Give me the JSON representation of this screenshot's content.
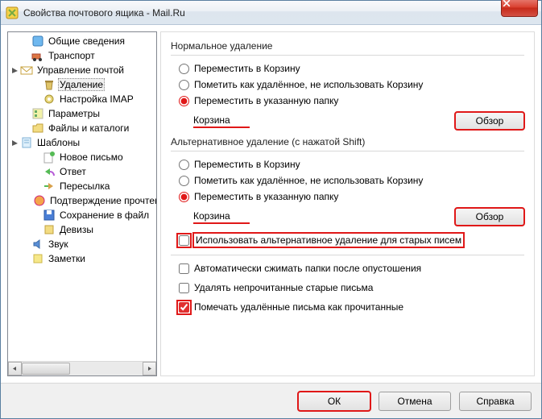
{
  "window": {
    "title": "Свойства почтового ящика - Mail.Ru"
  },
  "tree": {
    "items": [
      {
        "label": "Общие сведения"
      },
      {
        "label": "Транспорт"
      },
      {
        "label": "Управление почтой"
      },
      {
        "label": "Удаление"
      },
      {
        "label": "Настройка IMAP"
      },
      {
        "label": "Параметры"
      },
      {
        "label": "Файлы и каталоги"
      },
      {
        "label": "Шаблоны"
      },
      {
        "label": "Новое письмо"
      },
      {
        "label": "Ответ"
      },
      {
        "label": "Пересылка"
      },
      {
        "label": "Подтверждение прочтения"
      },
      {
        "label": "Сохранение в файл"
      },
      {
        "label": "Девизы"
      },
      {
        "label": "Звук"
      },
      {
        "label": "Заметки"
      }
    ]
  },
  "normal": {
    "heading": "Нормальное удаление",
    "opt1": "Переместить в Корзину",
    "opt2": "Пометить как удалённое, не использовать Корзину",
    "opt3": "Переместить в указанную папку",
    "folder": "Корзина",
    "browse": "Обзор"
  },
  "alt": {
    "heading": "Альтернативное удаление (с нажатой Shift)",
    "opt1": "Переместить в Корзину",
    "opt2": "Пометить как удалённое, не использовать Корзину",
    "opt3": "Переместить в указанную папку",
    "folder": "Корзина",
    "browse": "Обзор"
  },
  "checks": {
    "use_alt": "Использовать альтернативное удаление для старых писем",
    "compact": "Автоматически сжимать папки после опустошения",
    "del_unread": "Удалять непрочитанные старые письма",
    "mark_read": "Помечать удалённые письма как прочитанные"
  },
  "buttons": {
    "ok": "ОК",
    "cancel": "Отмена",
    "help": "Справка"
  }
}
